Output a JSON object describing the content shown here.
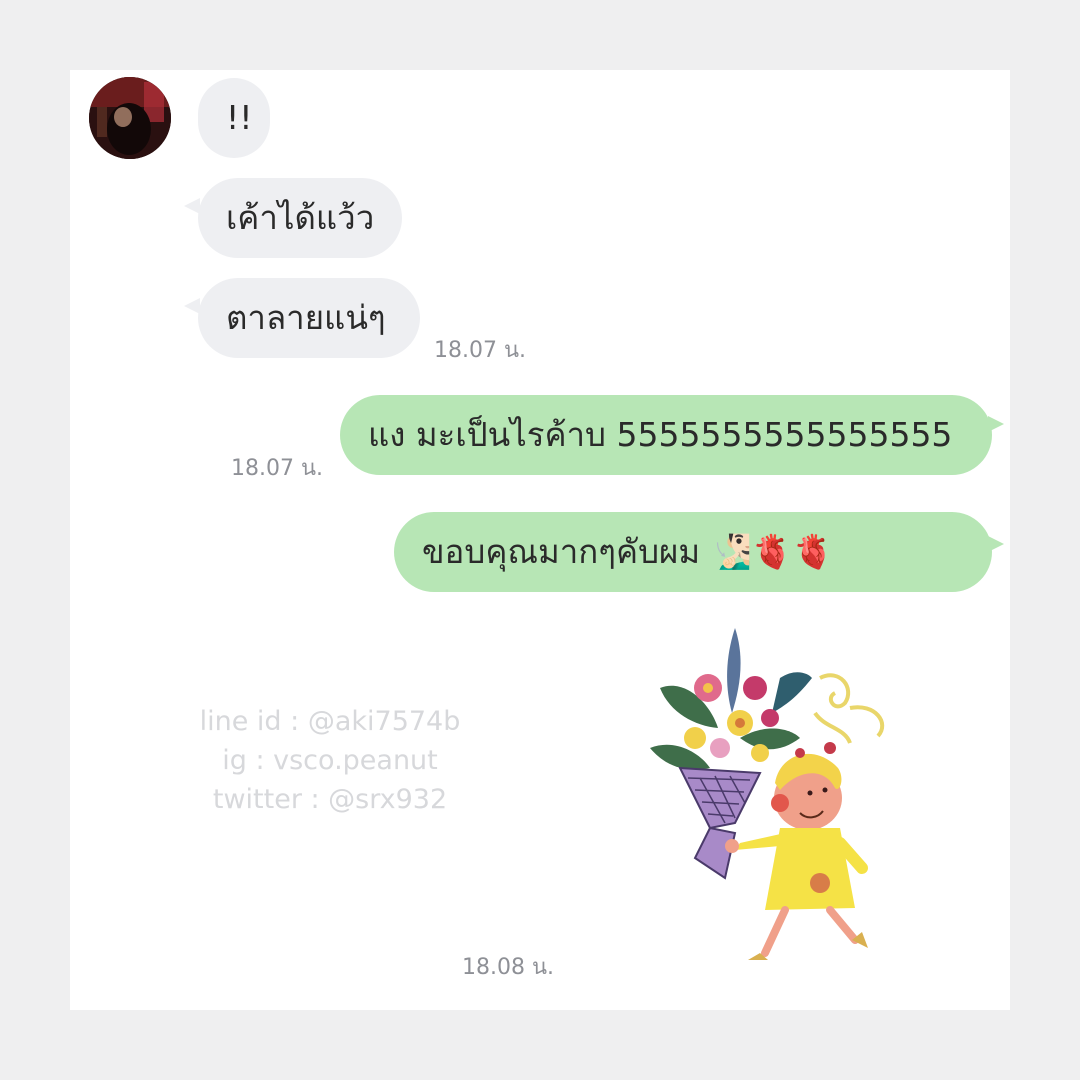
{
  "conversation": {
    "incoming": [
      {
        "text": "!!"
      },
      {
        "text": "เค้าได้แว้ว"
      },
      {
        "text": "ตาลายแน่ๆ"
      }
    ],
    "incoming_time": "18.07 น.",
    "outgoing": [
      {
        "text": "แง มะเป็นไรค้าบ 5555555555555555"
      },
      {
        "text": "ขอบคุณมากๆคับผม 🧏🏻‍♂️🫀🫀"
      }
    ],
    "outgoing_time": "18.07 น.",
    "sticker_time": "18.08 น."
  },
  "watermark": {
    "line1": "line id : @aki7574b",
    "line2": "ig : vsco.peanut",
    "line3": "twitter : @srx932"
  },
  "colors": {
    "incoming_bubble": "#eeeff2",
    "outgoing_bubble": "#b7e6b5",
    "timestamp": "#8e9096",
    "watermark": "#d7d8db"
  },
  "icons": {
    "avatar": "contact-avatar",
    "sticker": "girl-with-flower-bouquet-sticker"
  }
}
